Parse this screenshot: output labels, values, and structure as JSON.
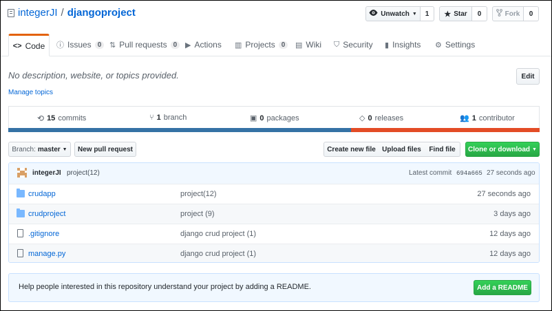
{
  "repo": {
    "owner": "integerJI",
    "separator": "/",
    "name": "djangoproject"
  },
  "actions": {
    "watch": {
      "icon": "eye-icon",
      "label": "Unwatch",
      "count": "1"
    },
    "star": {
      "icon": "star-icon",
      "label": "Star",
      "count": "0"
    },
    "fork": {
      "icon": "fork-icon",
      "label": "Fork",
      "count": "0"
    }
  },
  "tabs": [
    {
      "icon": "code-icon",
      "label": "Code",
      "selected": true
    },
    {
      "icon": "issue-icon",
      "label": "Issues",
      "count": "0"
    },
    {
      "icon": "pull-request-icon",
      "label": "Pull requests",
      "count": "0"
    },
    {
      "icon": "play-icon",
      "label": "Actions"
    },
    {
      "icon": "project-icon",
      "label": "Projects",
      "count": "0"
    },
    {
      "icon": "book-icon",
      "label": "Wiki"
    },
    {
      "icon": "shield-icon",
      "label": "Security"
    },
    {
      "icon": "graph-icon",
      "label": "Insights"
    },
    {
      "icon": "gear-icon",
      "label": "Settings"
    }
  ],
  "description": {
    "text": "No description, website, or topics provided.",
    "manage_topics": "Manage topics",
    "edit_label": "Edit"
  },
  "summary": {
    "commits": {
      "count": "15",
      "label": "commits"
    },
    "branches": {
      "count": "1",
      "label": "branch"
    },
    "packages": {
      "count": "0",
      "label": "packages"
    },
    "releases": {
      "count": "0",
      "label": "releases"
    },
    "contributors": {
      "count": "1",
      "label": "contributor"
    }
  },
  "languages": {
    "colors": [
      "#3572A5",
      "#e34c26"
    ],
    "fractions": [
      0.645,
      0.355
    ]
  },
  "toolbar": {
    "branch_prefix": "Branch:",
    "branch_name": "master",
    "new_pull_request": "New pull request",
    "create_new_file": "Create new file",
    "upload_files": "Upload files",
    "find_file": "Find file",
    "clone_or_download": "Clone or download"
  },
  "latest_commit": {
    "author": "integerJI",
    "message": "project(12)",
    "prefix": "Latest commit",
    "sha": "694a665",
    "age": "27 seconds ago"
  },
  "files": [
    {
      "type": "folder",
      "name": "crudapp",
      "message": "project(12)",
      "age": "27 seconds ago"
    },
    {
      "type": "folder",
      "name": "crudproject",
      "message": "project (9)",
      "age": "3 days ago"
    },
    {
      "type": "file",
      "name": ".gitignore",
      "message": "django crud project (1)",
      "age": "12 days ago"
    },
    {
      "type": "file",
      "name": "manage.py",
      "message": "django crud project (1)",
      "age": "12 days ago"
    }
  ],
  "readme": {
    "text": "Help people interested in this repository understand your project by adding a README.",
    "button": "Add a README"
  }
}
